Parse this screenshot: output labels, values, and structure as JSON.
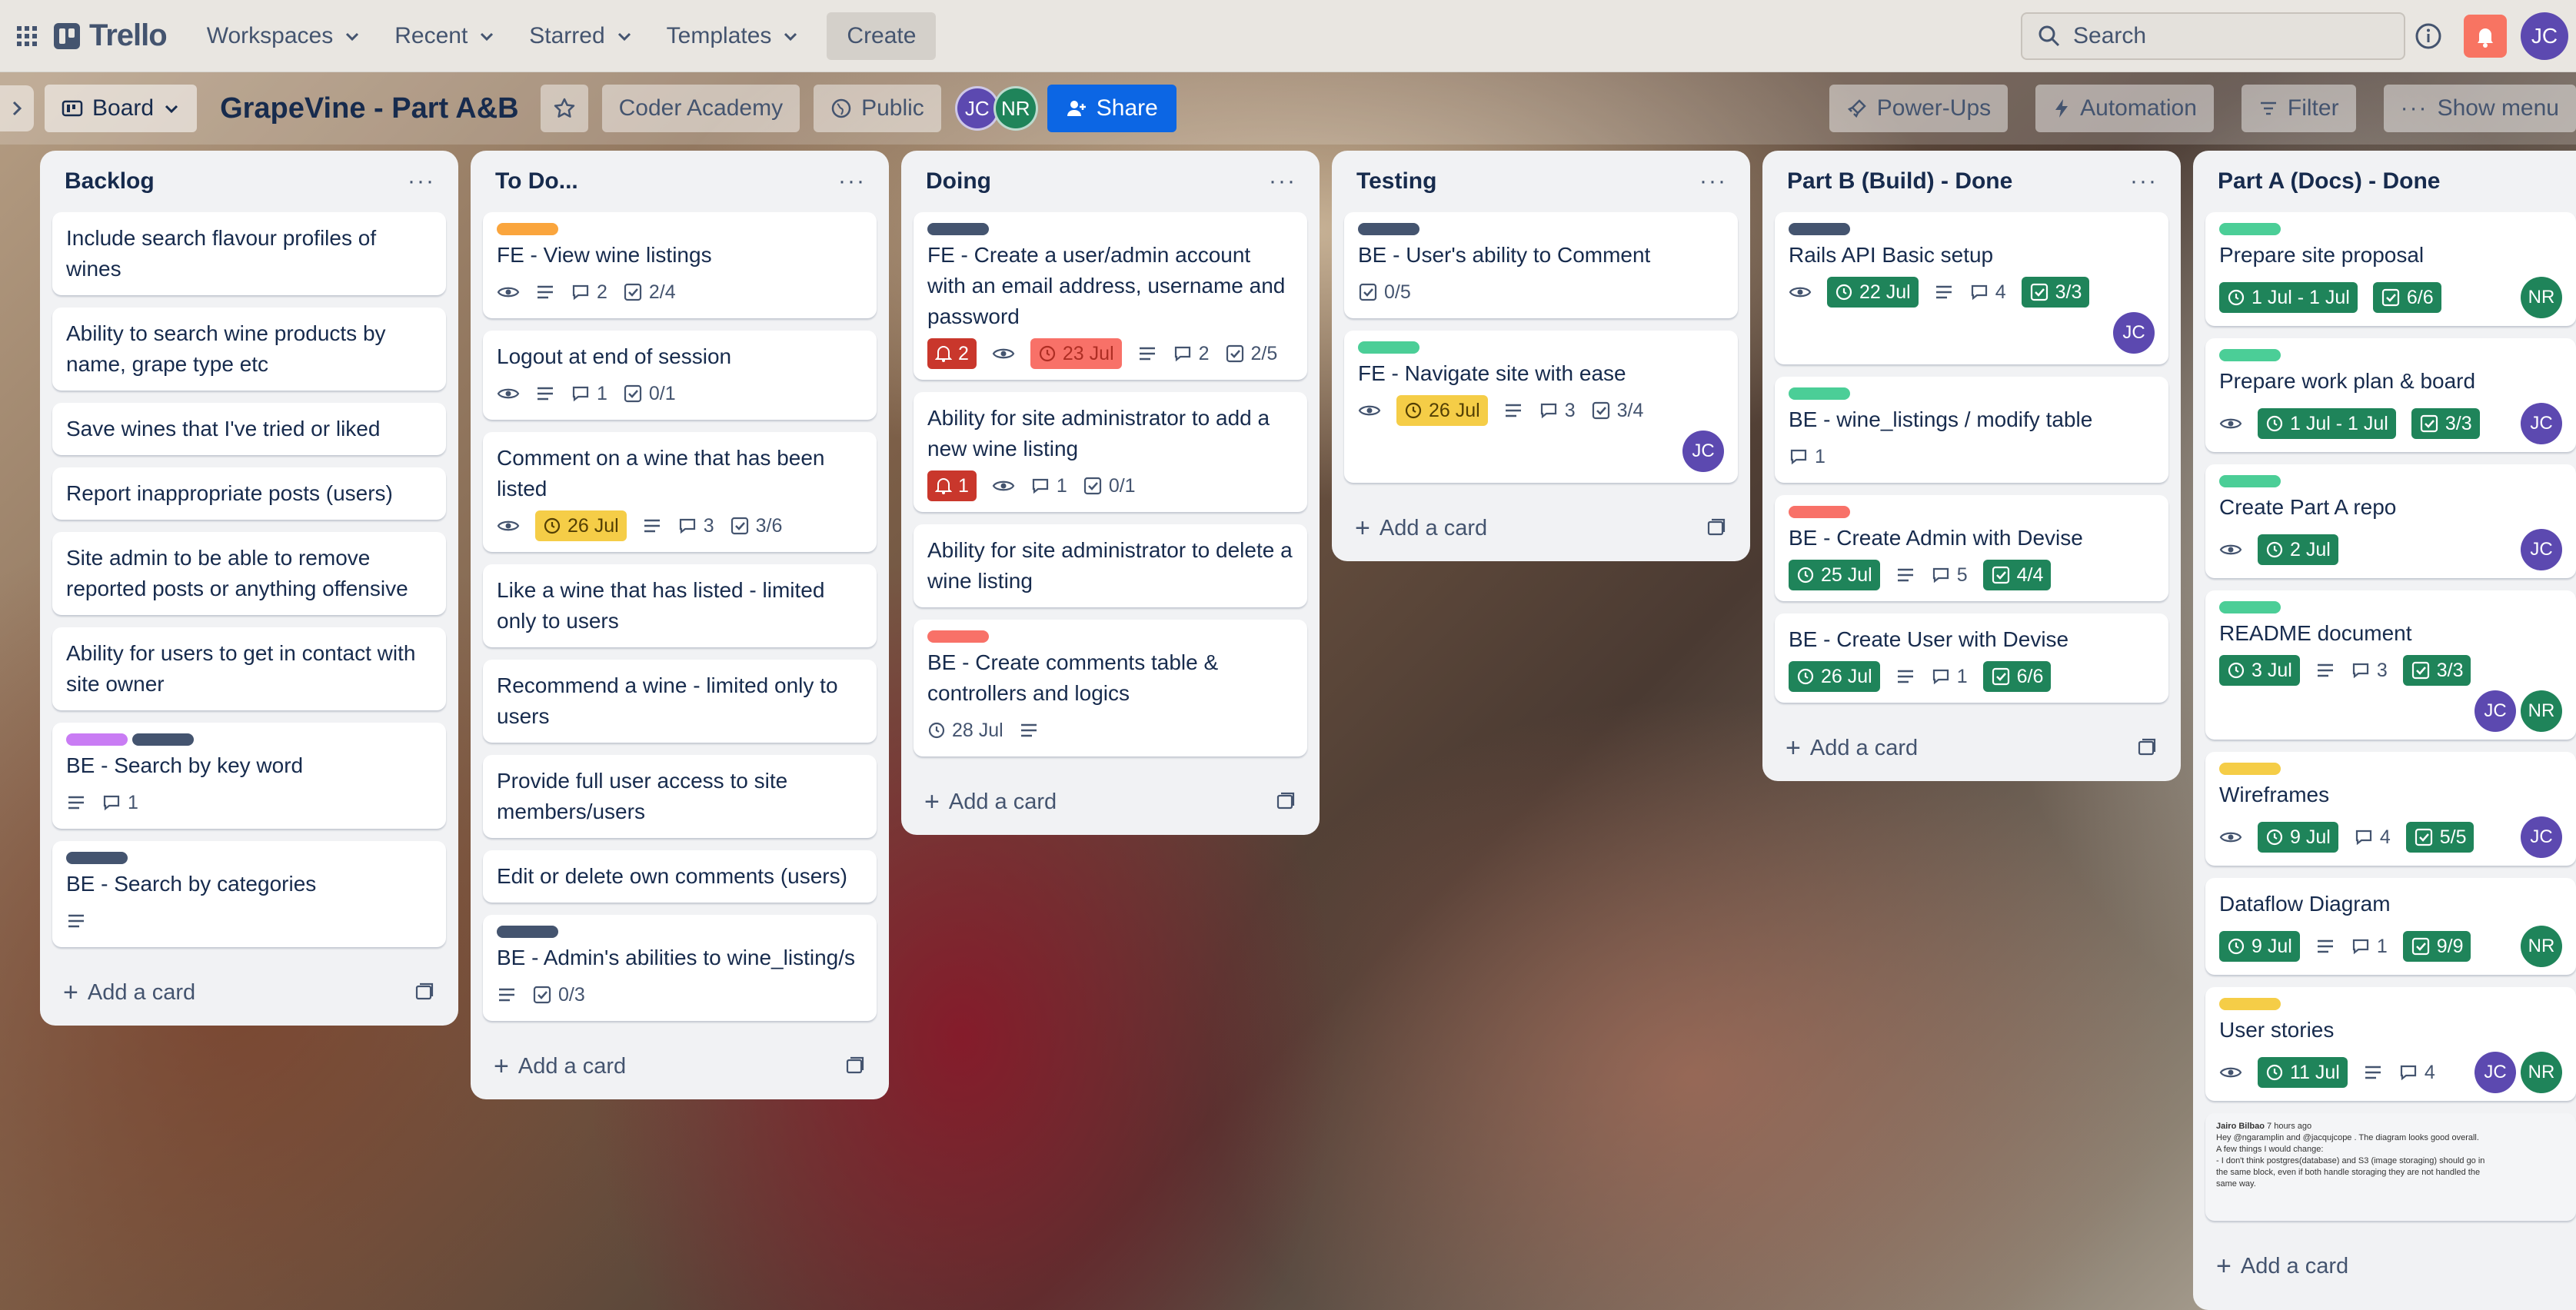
{
  "topbar": {
    "logo": "Trello",
    "nav": [
      "Workspaces",
      "Recent",
      "Starred",
      "Templates"
    ],
    "create": "Create",
    "search_placeholder": "Search",
    "user_initials": "JC"
  },
  "board": {
    "view": "Board",
    "title": "GrapeVine - Part A&B",
    "workspace": "Coder Academy",
    "visibility": "Public",
    "members": [
      "JC",
      "NR"
    ],
    "share": "Share",
    "power_ups": "Power-Ups",
    "automation": "Automation",
    "filter": "Filter",
    "show_menu": "Show menu"
  },
  "colors": {
    "green": "#4bce97",
    "orange": "#faa53d",
    "navy": "#44546f",
    "red": "#f87168",
    "yellow": "#f5cd47",
    "purple": "#c97cf4",
    "accent_blue": "#0c66e4",
    "avatar_jc": "#5c49b0",
    "avatar_nr": "#1f845a"
  },
  "add_card": "Add a card",
  "lists": [
    {
      "title": "Backlog",
      "cards": [
        {
          "title": "Include search flavour profiles of wines"
        },
        {
          "title": "Ability to search wine products by name, grape type etc"
        },
        {
          "title": "Save wines that I've tried or liked"
        },
        {
          "title": "Report inappropriate posts (users)"
        },
        {
          "title": "Site admin to be able to remove reported posts or anything offensive"
        },
        {
          "title": "Ability for users to get in contact with site owner"
        },
        {
          "title": "BE - Search by key word",
          "comments": "1"
        },
        {
          "title": "BE - Search by categories"
        }
      ]
    },
    {
      "title": "To Do...",
      "cards": [
        {
          "title": "FE - View wine listings",
          "comments": "2",
          "checklist": "2/4"
        },
        {
          "title": "Logout at end of session",
          "comments": "1",
          "checklist": "0/1"
        },
        {
          "title": "Comment on a wine that has been listed",
          "date": "26 Jul",
          "comments": "3",
          "checklist": "3/6"
        },
        {
          "title": "Like a wine that has listed - limited only to users"
        },
        {
          "title": "Recommend a wine - limited only to users"
        },
        {
          "title": "Provide full user access to site members/users"
        },
        {
          "title": "Edit or delete own comments (users)"
        },
        {
          "title": "BE - Admin's abilities to wine_listing/s",
          "checklist": "0/3"
        }
      ]
    },
    {
      "title": "Doing",
      "cards": [
        {
          "title": "FE - Create a user/admin account with an email address, username and password",
          "alerts": "2",
          "date": "23 Jul",
          "comments": "2",
          "checklist": "2/5"
        },
        {
          "title": "Ability for site administrator to add a new wine listing",
          "alerts": "1",
          "comments": "1",
          "checklist": "0/1"
        },
        {
          "title": "Ability for site administrator to delete a wine listing"
        },
        {
          "title": "BE - Create comments table & controllers and logics",
          "date": "28 Jul"
        }
      ]
    },
    {
      "title": "Testing",
      "cards": [
        {
          "title": "BE - User's ability to Comment",
          "checklist": "0/5"
        },
        {
          "title": "FE - Navigate site with ease",
          "date": "26 Jul",
          "comments": "3",
          "checklist": "3/4",
          "avatar": "JC"
        }
      ]
    },
    {
      "title": "Part B (Build) - Done",
      "cards": [
        {
          "title": "Rails API Basic setup",
          "date": "22 Jul",
          "comments": "4",
          "checklist": "3/3",
          "avatar": "JC"
        },
        {
          "title": "BE - wine_listings / modify table",
          "comments": "1"
        },
        {
          "title": "BE - Create Admin with Devise",
          "date": "25 Jul",
          "comments": "5",
          "checklist": "4/4"
        },
        {
          "title": "BE - Create User with Devise",
          "date": "26 Jul",
          "comments": "1",
          "checklist": "6/6"
        }
      ]
    },
    {
      "title": "Part A (Docs) - Done",
      "cards": [
        {
          "title": "Prepare site proposal",
          "date": "1 Jul - 1 Jul",
          "checklist": "6/6",
          "avatar": "NR"
        },
        {
          "title": "Prepare work plan & board",
          "date": "1 Jul - 1 Jul",
          "checklist": "3/3",
          "avatar": "JC"
        },
        {
          "title": "Create Part A repo",
          "date": "2 Jul",
          "avatar": "JC"
        },
        {
          "title": "README document",
          "date": "3 Jul",
          "comments": "3",
          "checklist": "3/3",
          "avatars": [
            "JC",
            "NR"
          ]
        },
        {
          "title": "Wireframes",
          "date": "9 Jul",
          "comments": "4",
          "checklist": "5/5",
          "avatar": "JC"
        },
        {
          "title": "Dataflow Diagram",
          "date": "9 Jul",
          "comments": "1",
          "checklist": "9/9",
          "avatar": "NR"
        },
        {
          "title": "User stories",
          "date": "11 Jul",
          "comments": "4",
          "avatars": [
            "JC",
            "NR"
          ]
        }
      ],
      "attachment_text": {
        "author": "Jairo Bilbao",
        "time": "7 hours ago",
        "line1": "Hey @ngaramplin and @jacqujcope . The diagram looks good overall.",
        "line2": "A few things I would change:",
        "line3": "- I don't think postgres(database) and S3 (image storaging) should go in",
        "line4": "the same block, even if both handle storaging they are not handled the",
        "line5": "same way."
      }
    }
  ]
}
